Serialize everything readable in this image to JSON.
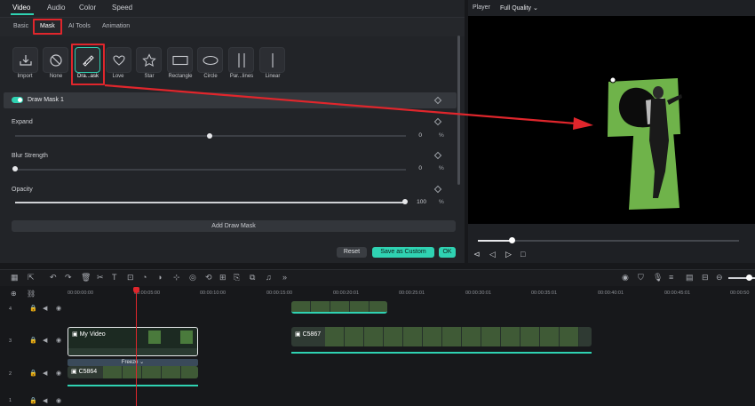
{
  "main_tabs": [
    "Video",
    "Audio",
    "Color",
    "Speed"
  ],
  "sub_tabs": [
    "Basic",
    "Mask",
    "AI Tools",
    "Animation"
  ],
  "mask_tiles": [
    {
      "label": "Import",
      "icon": "import-icon"
    },
    {
      "label": "None",
      "icon": "none-icon"
    },
    {
      "label": "Dra...ask",
      "icon": "draw-mask-pen-icon"
    },
    {
      "label": "Love",
      "icon": "heart-icon"
    },
    {
      "label": "Star",
      "icon": "star-icon"
    },
    {
      "label": "Rectangle",
      "icon": "rectangle-icon"
    },
    {
      "label": "Circle",
      "icon": "circle-icon"
    },
    {
      "label": "Par...lines",
      "icon": "parallel-lines-icon"
    },
    {
      "label": "Linear",
      "icon": "linear-icon"
    }
  ],
  "mask_row": {
    "label": "Draw Mask 1"
  },
  "params": [
    {
      "label": "Expand",
      "value": "0",
      "unit": "%",
      "level": 0.5
    },
    {
      "label": "Blur Strength",
      "value": "0",
      "unit": "%",
      "level": 0.0
    },
    {
      "label": "Opacity",
      "value": "100",
      "unit": "%",
      "level": 1.0
    }
  ],
  "buttons": {
    "add_mask": "Add Draw Mask",
    "reset": "Reset",
    "save_custom": "Save as Custom",
    "ok": "OK"
  },
  "player": {
    "label": "Player",
    "quality": "Full Quality",
    "progress": 0.13
  },
  "timeline": {
    "timecodes": [
      "00:00:00:00",
      "00:00:05:00",
      "00:00:10:00",
      "00:00:15:00",
      "00:00:20:01",
      "00:00:25:01",
      "00:00:30:01",
      "00:00:35:01",
      "00:00:40:01",
      "00:00:45:01",
      "00:00:50"
    ],
    "tracks": [
      "4",
      "3",
      "2",
      "1"
    ],
    "clips": {
      "my_video": "My Video",
      "c5867": "C5867",
      "freeze": "Freeze",
      "c5864": "C5864"
    }
  },
  "colors": {
    "accent": "#2fd2b2",
    "highlight": "#e0262c",
    "green_screen": "#6fb34a"
  }
}
